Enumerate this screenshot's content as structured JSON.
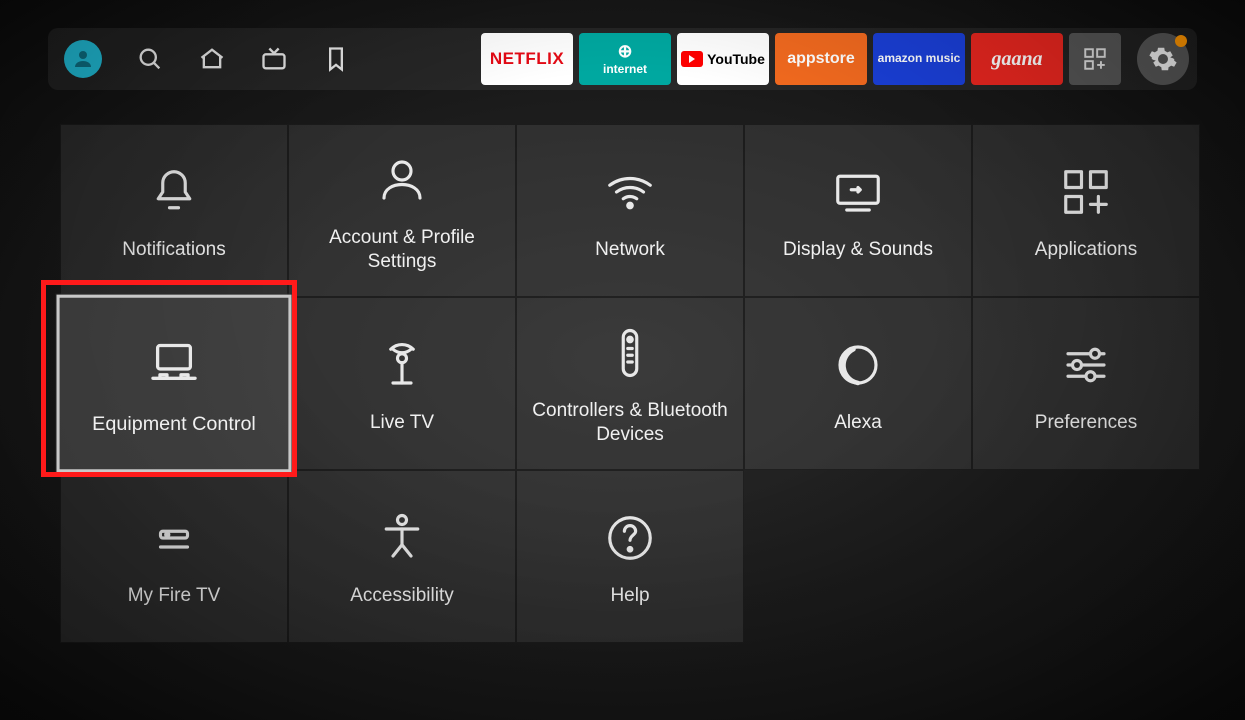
{
  "topbar": {
    "apps": [
      {
        "id": "netflix",
        "label": "NETFLIX"
      },
      {
        "id": "internet",
        "label": "internet"
      },
      {
        "id": "youtube",
        "label": "YouTube"
      },
      {
        "id": "appstore",
        "label": "appstore"
      },
      {
        "id": "amazonmusic",
        "label": "amazon music"
      },
      {
        "id": "gaana",
        "label": "gaana"
      }
    ]
  },
  "settings_tiles": [
    {
      "id": "notifications",
      "label": "Notifications",
      "icon": "bell"
    },
    {
      "id": "account-profile",
      "label": "Account & Profile Settings",
      "icon": "person"
    },
    {
      "id": "network",
      "label": "Network",
      "icon": "wifi"
    },
    {
      "id": "display-sounds",
      "label": "Display & Sounds",
      "icon": "display"
    },
    {
      "id": "applications",
      "label": "Applications",
      "icon": "apps"
    },
    {
      "id": "equipment-control",
      "label": "Equipment Control",
      "icon": "equipment",
      "selected": true
    },
    {
      "id": "live-tv",
      "label": "Live TV",
      "icon": "antenna"
    },
    {
      "id": "controllers-bt",
      "label": "Controllers & Bluetooth Devices",
      "icon": "remote"
    },
    {
      "id": "alexa",
      "label": "Alexa",
      "icon": "alexa"
    },
    {
      "id": "preferences",
      "label": "Preferences",
      "icon": "sliders"
    },
    {
      "id": "my-fire-tv",
      "label": "My Fire TV",
      "icon": "firetv"
    },
    {
      "id": "accessibility",
      "label": "Accessibility",
      "icon": "accessibility"
    },
    {
      "id": "help",
      "label": "Help",
      "icon": "help"
    }
  ],
  "colors": {
    "highlight": "#ff1a1a",
    "notification_dot": "#ff9500",
    "avatar": "#1fb6d0"
  }
}
